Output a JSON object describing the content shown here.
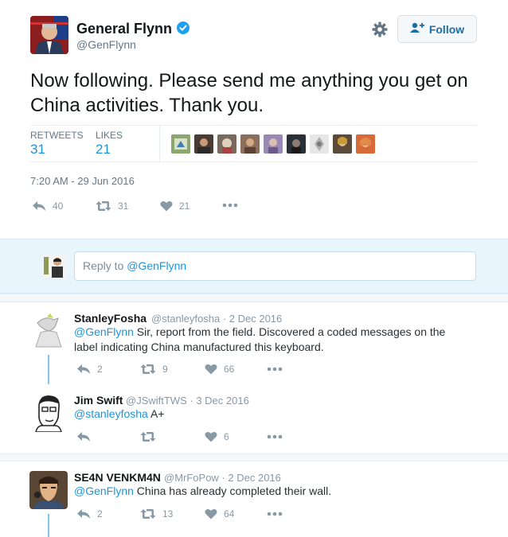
{
  "tweet": {
    "author_name": "General Flynn",
    "author_handle": "@GenFlynn",
    "verified": true,
    "follow_label": "Follow",
    "text": "Now following. Please send me anything you get on China activities. Thank you.",
    "stats": {
      "retweets_label": "RETWEETS",
      "retweets": "31",
      "likes_label": "LIKES",
      "likes": "21"
    },
    "timestamp": "7:20 AM - 29 Jun 2016",
    "actions": {
      "reply_count": "40",
      "retweet_count": "31",
      "like_count": "21"
    }
  },
  "reply_box": {
    "prefix": "Reply to ",
    "mention": "@GenFlynn"
  },
  "replies": [
    {
      "name": "StanleyFosha",
      "handle": "@stanleyfosha",
      "date": "· 2 Dec 2016",
      "mention": "@GenFlynn",
      "text": " Sir, report from the field. Discovered a coded messages on the label indicating China manufactured this keyboard.",
      "reply_count": "2",
      "retweet_count": "9",
      "like_count": "66"
    },
    {
      "name": "Jim Swift",
      "handle": "@JSwiftTWS",
      "date": "· 3 Dec 2016",
      "mention": "@stanleyfosha",
      "text": " A+",
      "reply_count": "",
      "retweet_count": "",
      "like_count": "6"
    },
    {
      "name": "SE4N VENKM4N",
      "handle": "@MrFoPow",
      "date": "· 2 Dec 2016",
      "mention": "@GenFlynn",
      "text": " China has already completed their wall.",
      "reply_count": "2",
      "retweet_count": "13",
      "like_count": "64"
    }
  ],
  "colors": {
    "accent": "#1b95e0",
    "muted": "#8899a6",
    "verified": "#1da1f2",
    "reply_band": "#e8f5fd"
  },
  "icons": [
    "gear-icon",
    "follow-person-icon",
    "verified-icon",
    "reply-icon",
    "retweet-icon",
    "heart-icon",
    "more-icon"
  ]
}
